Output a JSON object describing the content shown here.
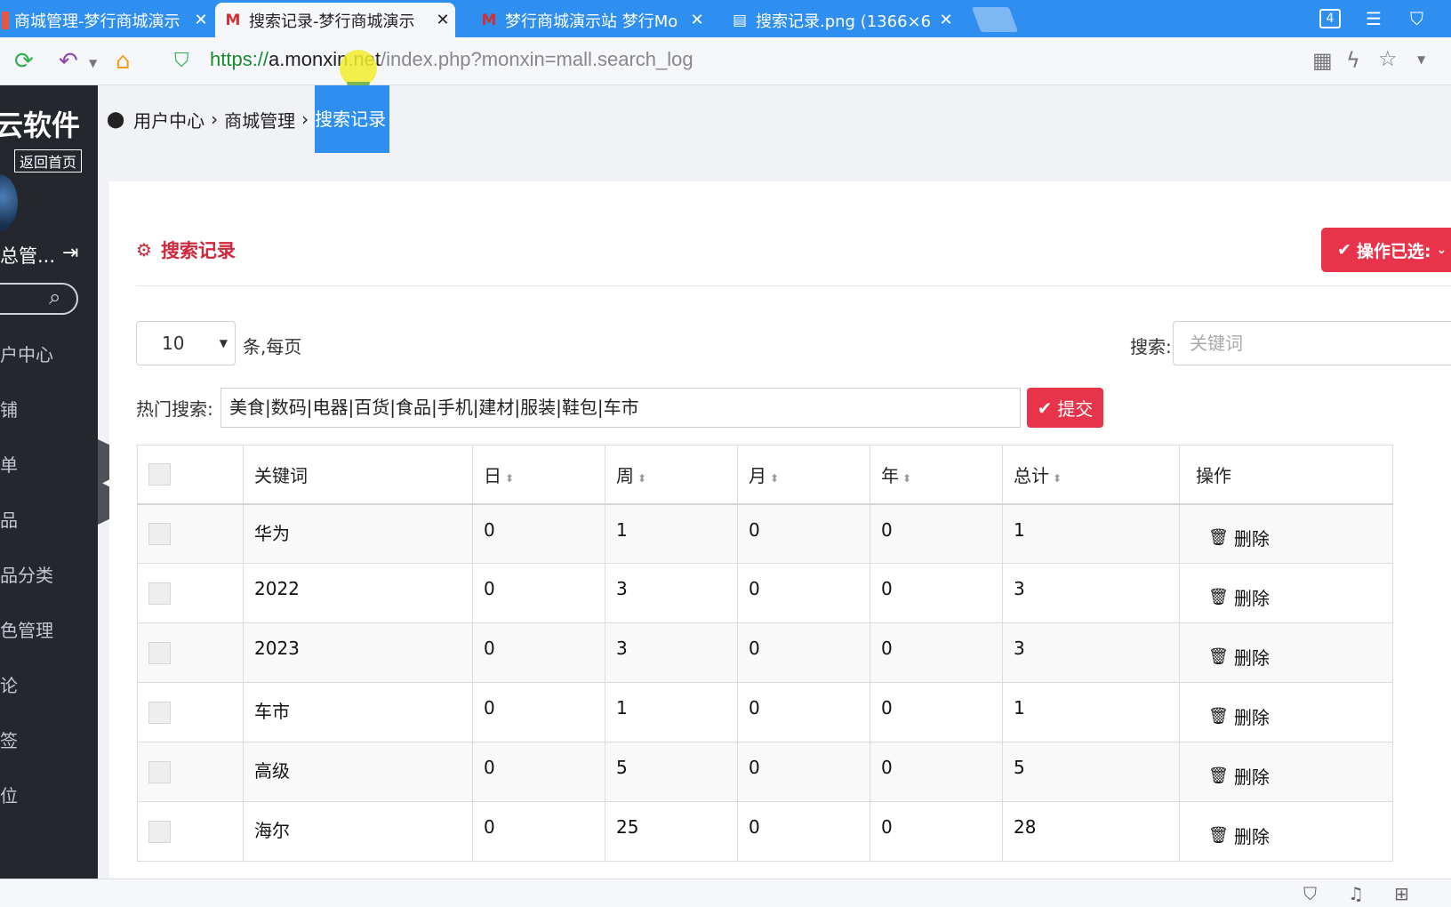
{
  "browser": {
    "tabs": [
      {
        "icon": "document-icon",
        "title": "商城管理-梦行商城演示",
        "active": false
      },
      {
        "icon": "m-logo-icon",
        "title": "搜索记录-梦行商城演示",
        "active": true
      },
      {
        "icon": "m-logo-icon",
        "title": "梦行商城演示站 梦行Mo",
        "active": false
      },
      {
        "icon": "document-icon",
        "title": "搜索记录.png (1366×6",
        "active": false
      }
    ],
    "tab_count": "4",
    "url": {
      "scheme": "https://",
      "host": "a.monxin.net",
      "path": "/index.php?monxin=mall.search_log"
    }
  },
  "sidebar": {
    "brand": "云软件",
    "home_link": "返回首页",
    "user_name": "总管...",
    "menu": [
      "户中心",
      "铺",
      "单",
      "品",
      "品分类",
      "色管理",
      "论",
      "签",
      "位"
    ]
  },
  "breadcrumb": {
    "items": [
      "用户中心",
      "商城管理"
    ],
    "current": "搜索记录",
    "separator": "›"
  },
  "panel": {
    "title": "搜索记录",
    "bulk_action": "操作已选:",
    "page_size": "10",
    "per_page_label": "条,每页",
    "search_label": "搜索:",
    "search_placeholder": "关键词",
    "hot_label": "热门搜索:",
    "hot_value": "美食|数码|电器|百货|食品|手机|建材|服装|鞋包|车市",
    "submit": "提交"
  },
  "table": {
    "headers": {
      "keyword": "关键词",
      "day": "日",
      "week": "周",
      "month": "月",
      "year": "年",
      "total": "总计",
      "action": "操作"
    },
    "delete_label": "删除",
    "rows": [
      {
        "keyword": "华为",
        "day": "0",
        "week": "1",
        "month": "0",
        "year": "0",
        "total": "1"
      },
      {
        "keyword": "2022",
        "day": "0",
        "week": "3",
        "month": "0",
        "year": "0",
        "total": "3"
      },
      {
        "keyword": "2023",
        "day": "0",
        "week": "3",
        "month": "0",
        "year": "0",
        "total": "3"
      },
      {
        "keyword": "车市",
        "day": "0",
        "week": "1",
        "month": "0",
        "year": "0",
        "total": "1"
      },
      {
        "keyword": "高级",
        "day": "0",
        "week": "5",
        "month": "0",
        "year": "0",
        "total": "5"
      },
      {
        "keyword": "海尔",
        "day": "0",
        "week": "25",
        "month": "0",
        "year": "0",
        "total": "28"
      }
    ]
  },
  "colors": {
    "accent_blue": "#2e8ff0",
    "danger_red": "#e8344b",
    "title_red": "#d0283b",
    "sidebar_bg": "#24272e"
  }
}
